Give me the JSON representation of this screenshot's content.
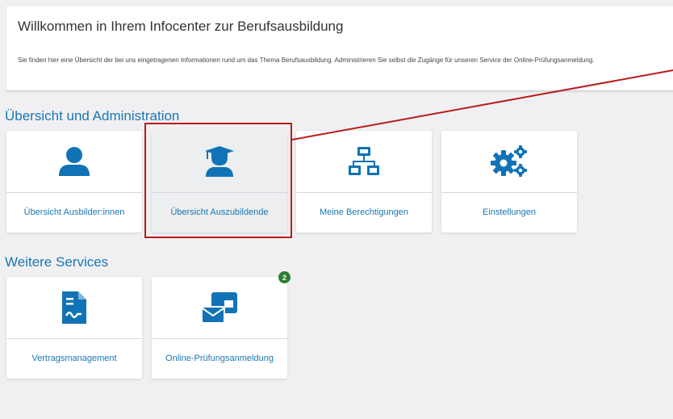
{
  "welcome": {
    "title": "Willkommen in Ihrem Infocenter zur Berufsausbildung",
    "description": "Sie finden hier eine Übersicht der bei uns eingetragenen Informationen rund um das Thema Berufsausbildung. Administrieren Sie selbst die Zugänge für unseren Service der Online-Prüfungsanmeldung."
  },
  "sections": {
    "admin": {
      "title": "Übersicht und Administration",
      "tiles": [
        {
          "label": "Übersicht Ausbilder:innen",
          "icon": "person-icon"
        },
        {
          "label": "Übersicht Auszubildende",
          "icon": "graduate-icon"
        },
        {
          "label": "Meine Berechtigungen",
          "icon": "network-icon"
        },
        {
          "label": "Einstellungen",
          "icon": "gears-icon"
        }
      ]
    },
    "services": {
      "title": "Weitere Services",
      "tiles": [
        {
          "label": "Vertragsmanagement",
          "icon": "contract-document-icon"
        },
        {
          "label": "Online-Prüfungsanmeldung",
          "icon": "mail-registration-icon",
          "badge": "2"
        }
      ]
    }
  },
  "colors": {
    "accent": "#1a77b3",
    "icon": "#1173b6",
    "badge": "#2e7d32",
    "highlight": "#b71c1c"
  }
}
